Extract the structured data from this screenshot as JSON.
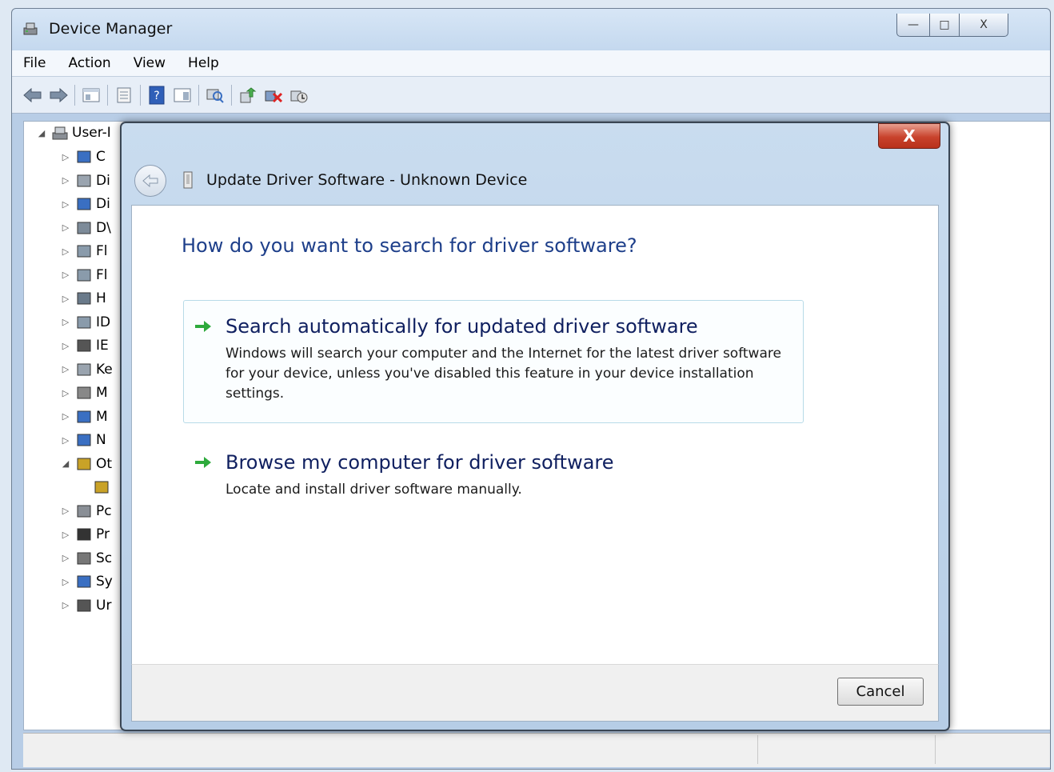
{
  "window": {
    "title": "Device Manager",
    "controls": {
      "minimize": "—",
      "maximize": "□",
      "close": "X"
    }
  },
  "menu": [
    "File",
    "Action",
    "View",
    "Help"
  ],
  "toolbar": {
    "icons": [
      "back-icon",
      "forward-icon",
      "show-hide-tree-icon",
      "properties-icon",
      "help-icon",
      "action-pane-icon",
      "scan-hardware-icon",
      "update-driver-icon",
      "uninstall-icon",
      "disable-icon"
    ]
  },
  "tree": {
    "root": "User-I",
    "items": [
      {
        "label": "C",
        "icon": "computer-icon",
        "expanded": false
      },
      {
        "label": "Di",
        "icon": "disk-drive-icon",
        "expanded": false
      },
      {
        "label": "Di",
        "icon": "display-adapter-icon",
        "expanded": false
      },
      {
        "label": "D\\",
        "icon": "dvd-drive-icon",
        "expanded": false
      },
      {
        "label": "Fl",
        "icon": "floppy-controller-icon",
        "expanded": false
      },
      {
        "label": "Fl",
        "icon": "floppy-drive-icon",
        "expanded": false
      },
      {
        "label": "H",
        "icon": "hid-icon",
        "expanded": false
      },
      {
        "label": "ID",
        "icon": "ide-controller-icon",
        "expanded": false
      },
      {
        "label": "IE",
        "icon": "ieee1394-icon",
        "expanded": false
      },
      {
        "label": "Ke",
        "icon": "keyboard-icon",
        "expanded": false
      },
      {
        "label": "M",
        "icon": "mouse-icon",
        "expanded": false
      },
      {
        "label": "M",
        "icon": "monitor-icon",
        "expanded": false
      },
      {
        "label": "N",
        "icon": "network-adapter-icon",
        "expanded": false
      },
      {
        "label": "Ot",
        "icon": "other-devices-icon",
        "expanded": true
      },
      {
        "label": "",
        "icon": "unknown-device-icon",
        "expanded": null
      },
      {
        "label": "Pc",
        "icon": "ports-icon",
        "expanded": false
      },
      {
        "label": "Pr",
        "icon": "processor-icon",
        "expanded": false
      },
      {
        "label": "Sc",
        "icon": "sound-icon",
        "expanded": false
      },
      {
        "label": "Sy",
        "icon": "system-devices-icon",
        "expanded": false
      },
      {
        "label": "Ur",
        "icon": "usb-controller-icon",
        "expanded": false
      }
    ]
  },
  "dialog": {
    "title": "Update Driver Software - Unknown Device",
    "close": "X",
    "question": "How do you want to search for driver software?",
    "options": [
      {
        "title": "Search automatically for updated driver software",
        "description": "Windows will search your computer and the Internet for the latest driver software for your device, unless you've disabled this feature in your device installation settings."
      },
      {
        "title": "Browse my computer for driver software",
        "description": "Locate and install driver software manually."
      }
    ],
    "cancel": "Cancel"
  },
  "colors": {
    "accent": "#1e3f8a",
    "arrow": "#2eaa3c",
    "close_red": "#c8422c"
  }
}
